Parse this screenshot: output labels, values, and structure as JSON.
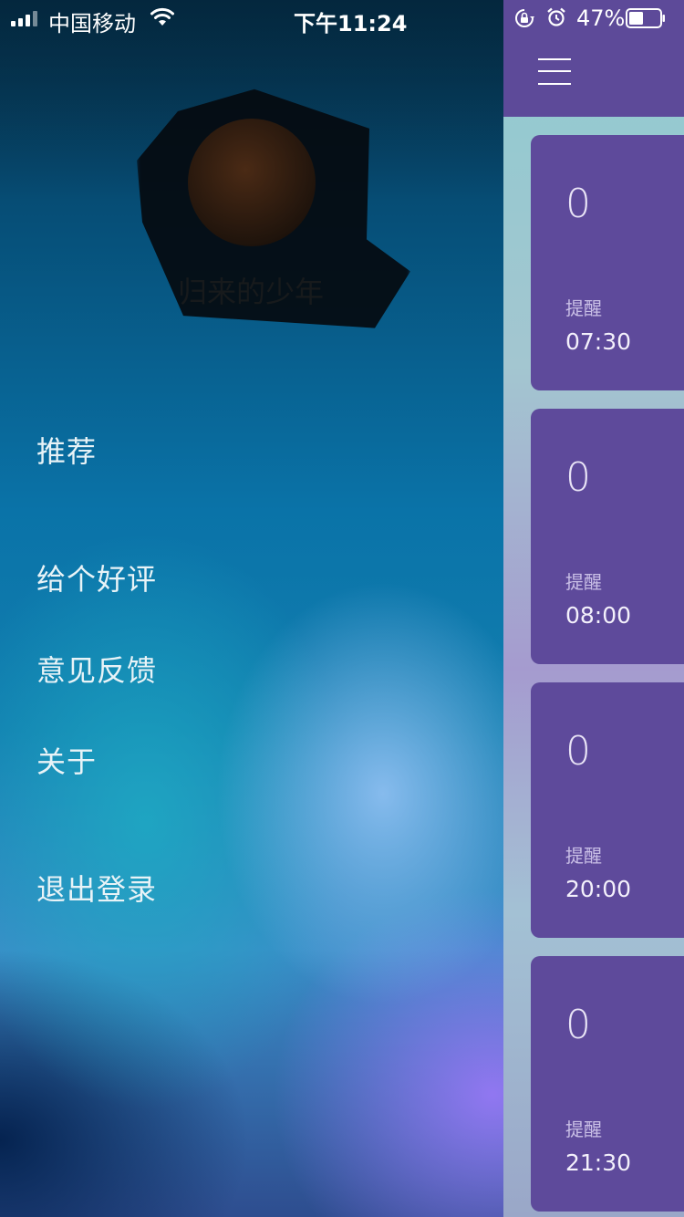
{
  "status_bar": {
    "carrier": "中国移动",
    "time": "下午11:24",
    "battery_percent": "47%",
    "battery_level": 0.47,
    "icons": [
      "signal-icon",
      "wifi-icon",
      "rotation-lock-icon",
      "alarm-icon",
      "battery-icon"
    ]
  },
  "drawer": {
    "username": "归来的少年",
    "menu": {
      "recommend": "推荐",
      "rate": "给个好评",
      "feedback": "意见反馈",
      "about": "关于",
      "logout": "退出登录"
    }
  },
  "main": {
    "menu_icon": "hamburger-menu-icon",
    "reminders": [
      {
        "count": "0",
        "label": "提醒",
        "time": "07:30"
      },
      {
        "count": "0",
        "label": "提醒",
        "time": "08:00"
      },
      {
        "count": "0",
        "label": "提醒",
        "time": "20:00"
      },
      {
        "count": "0",
        "label": "提醒",
        "time": "21:30"
      }
    ]
  },
  "colors": {
    "accent_purple": "#5e4a9b",
    "topbar_purple": "#5d4a99",
    "menu_text": "#e8f3f7"
  }
}
